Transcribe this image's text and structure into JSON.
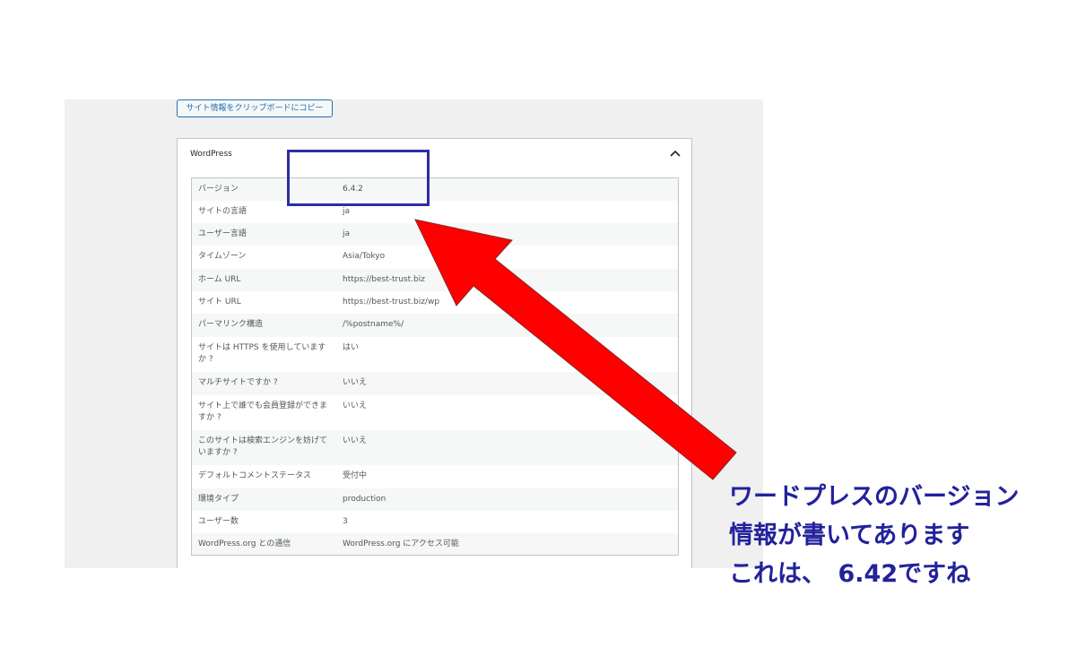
{
  "copy_button_label": "サイト情報をクリップボードにコピー",
  "panel": {
    "title": "WordPress"
  },
  "rows": [
    {
      "label": "バージョン",
      "value": "6.4.2"
    },
    {
      "label": "サイトの言語",
      "value": "ja"
    },
    {
      "label": "ユーザー言語",
      "value": "ja"
    },
    {
      "label": "タイムゾーン",
      "value": "Asia/Tokyo"
    },
    {
      "label": "ホーム URL",
      "value": "https://best-trust.biz"
    },
    {
      "label": "サイト URL",
      "value": "https://best-trust.biz/wp"
    },
    {
      "label": "パーマリンク構造",
      "value": "/%postname%/"
    },
    {
      "label": "サイトは HTTPS を使用していますか ?",
      "value": "はい"
    },
    {
      "label": "マルチサイトですか ?",
      "value": "いいえ"
    },
    {
      "label": "サイト上で誰でも会員登録ができますか ?",
      "value": "いいえ"
    },
    {
      "label": "このサイトは検索エンジンを妨げていますか ?",
      "value": "いいえ"
    },
    {
      "label": "デフォルトコメントステータス",
      "value": "受付中"
    },
    {
      "label": "環境タイプ",
      "value": "production"
    },
    {
      "label": "ユーザー数",
      "value": "3"
    },
    {
      "label": "WordPress.org との通信",
      "value": "WordPress.org にアクセス可能"
    }
  ],
  "annotation": {
    "line1": "ワードプレスのバージョン",
    "line2": "情報が書いてあります",
    "line3": "これは、　6.42ですね"
  },
  "colors": {
    "arrow": "#ff0000",
    "highlight_box": "#2b2fa0",
    "annotation_text": "#22229b"
  }
}
